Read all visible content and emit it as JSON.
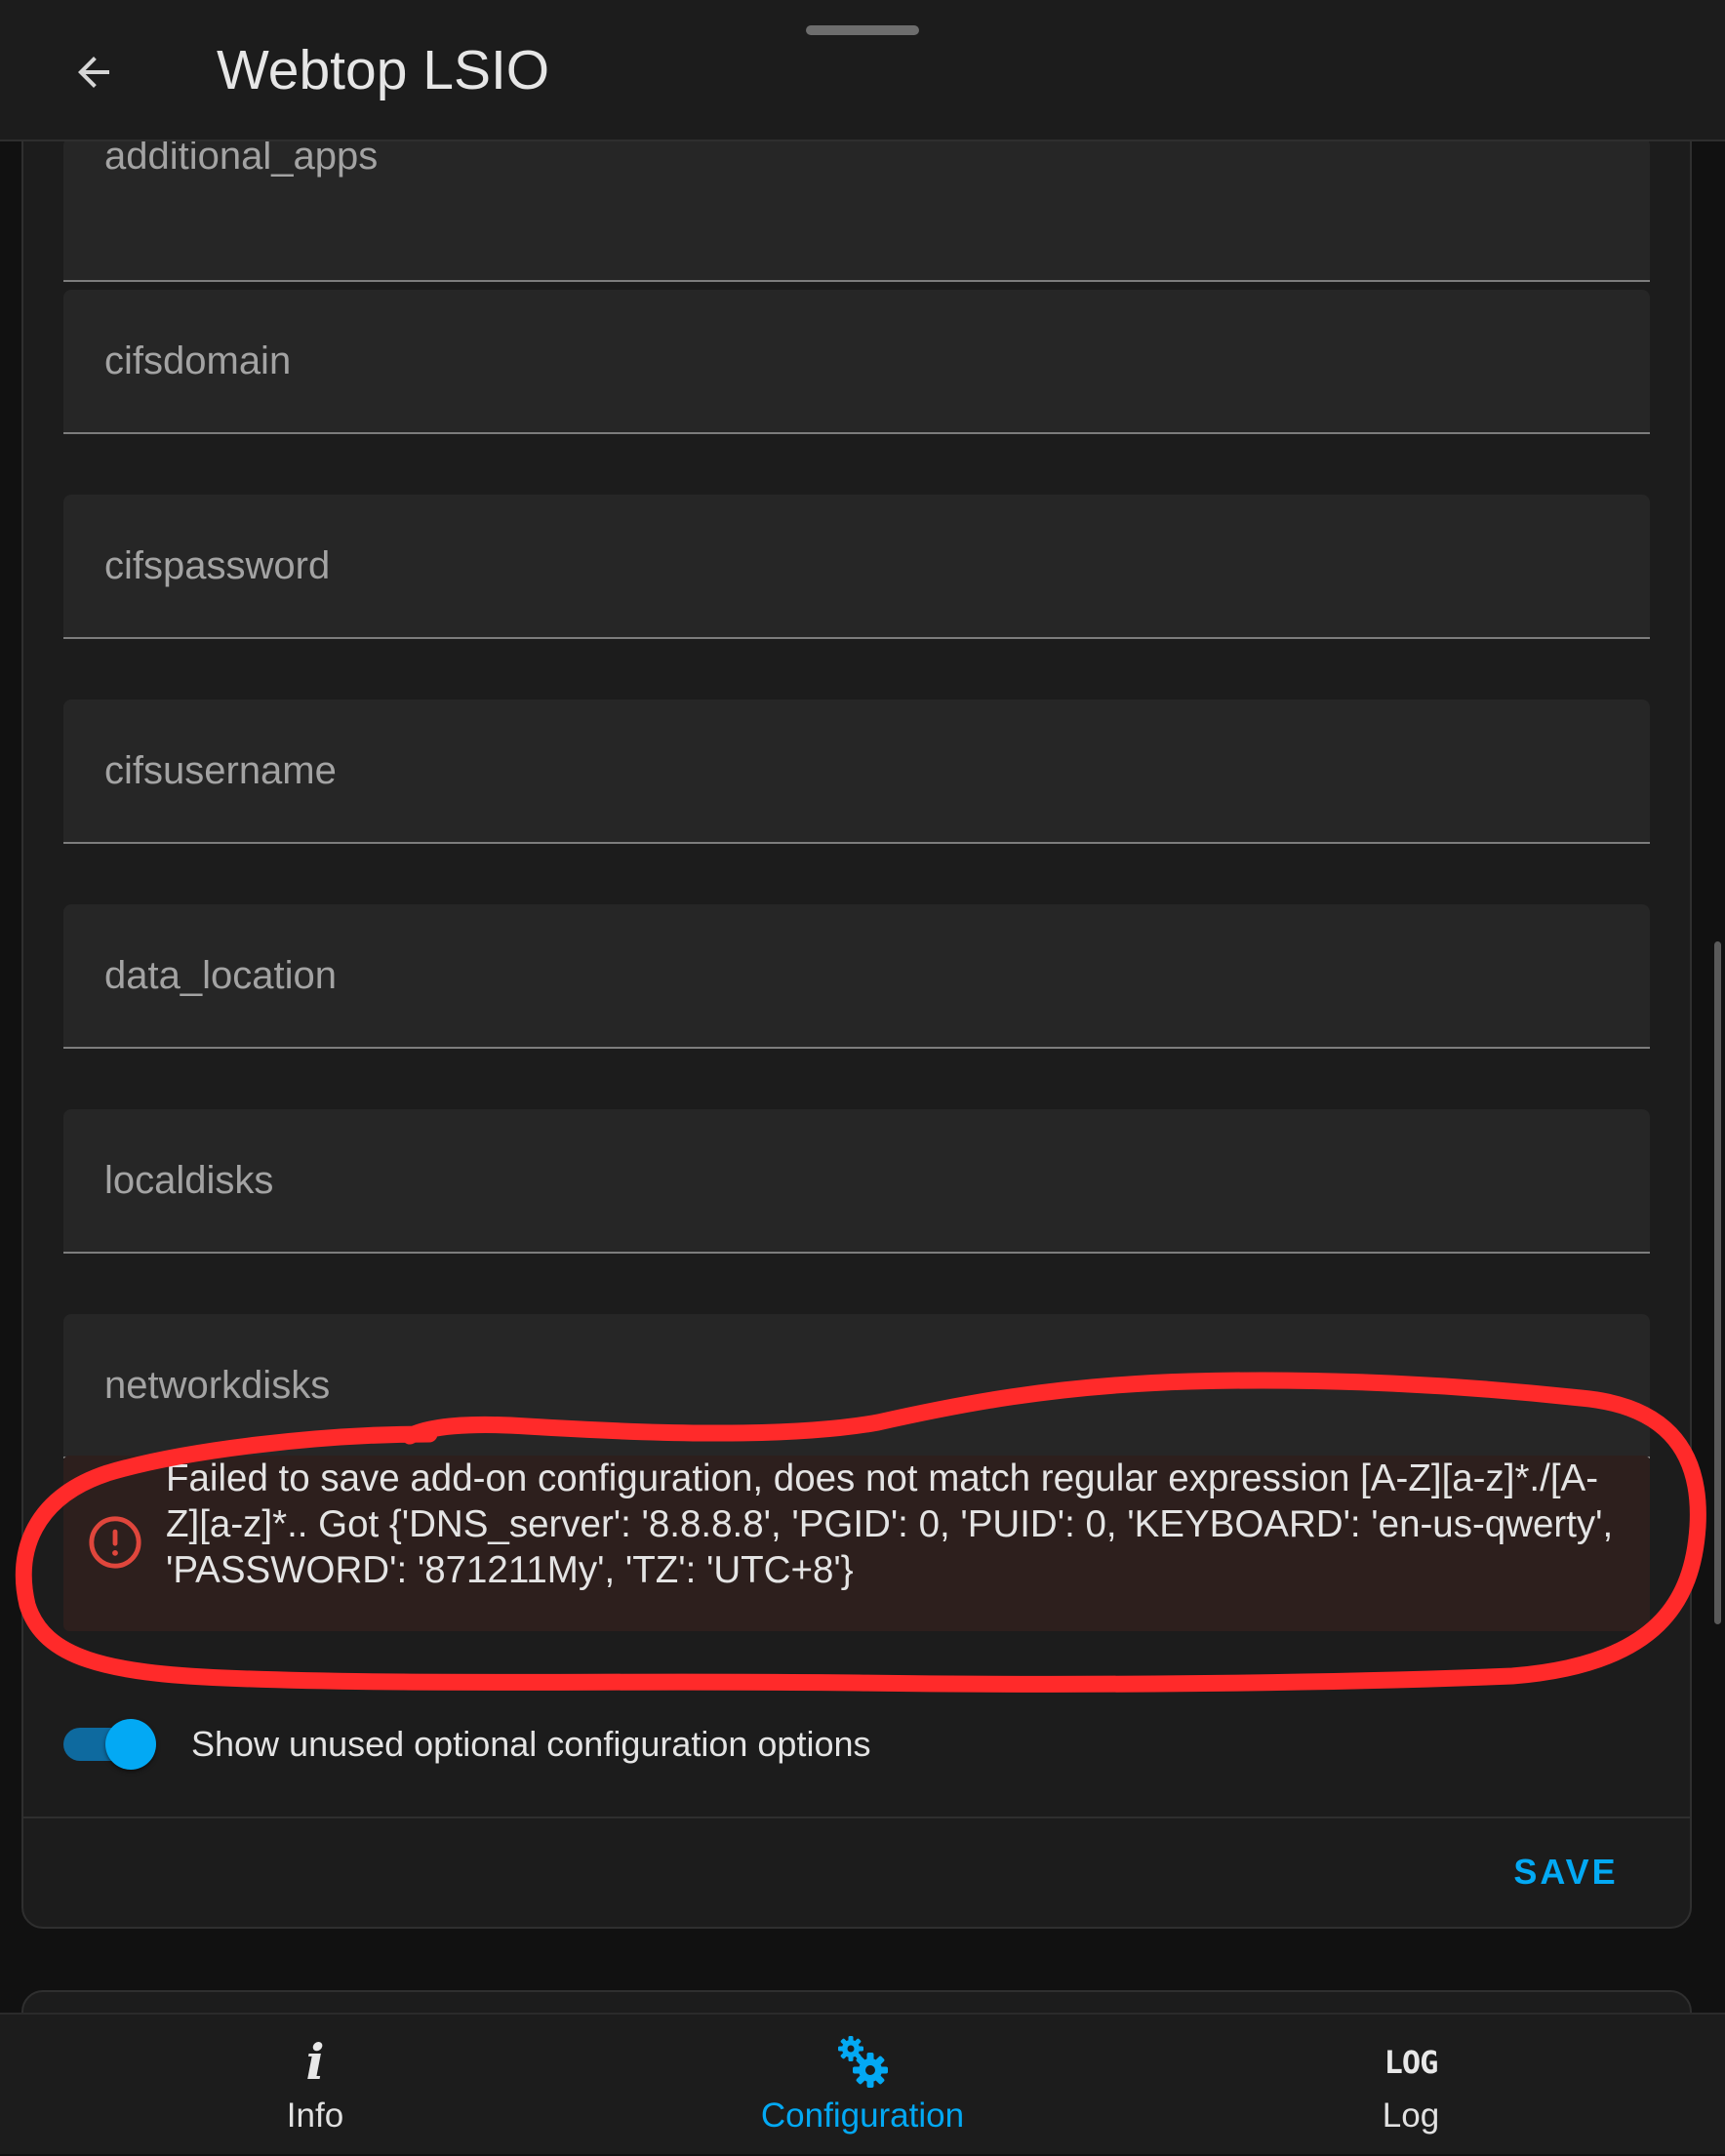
{
  "header": {
    "title": "Webtop LSIO",
    "back_icon": "arrow-left-icon"
  },
  "fields": [
    {
      "label": "additional_apps"
    },
    {
      "label": "cifsdomain"
    },
    {
      "label": "cifspassword"
    },
    {
      "label": "cifsusername"
    },
    {
      "label": "data_location"
    },
    {
      "label": "localdisks"
    },
    {
      "label": "networkdisks"
    }
  ],
  "error": {
    "icon": "alert-circle-icon",
    "message": "Failed to save add-on configuration, does not match regular expression [A-Z][a-z]*./[A-Z][a-z]*.. Got {'DNS_server': '8.8.8.8', 'PGID': 0, 'PUID': 0, 'KEYBOARD': 'en-us-qwerty', 'PASSWORD': '871211My', 'TZ': 'UTC+8'}"
  },
  "toggle": {
    "label": "Show unused optional configuration options",
    "checked": true
  },
  "actions": {
    "save_label": "SAVE"
  },
  "bottom_nav": {
    "items": [
      {
        "label": "Info",
        "icon": "info-icon",
        "active": false
      },
      {
        "label": "Configuration",
        "icon": "cogs-icon",
        "active": true
      },
      {
        "label": "Log",
        "icon": "log-icon",
        "active": false
      }
    ],
    "info_glyph": "i",
    "log_glyph": "LOG"
  },
  "colors": {
    "accent": "#03a9f4",
    "background": "#111111",
    "card": "#1c1c1c",
    "field": "#262626",
    "error_bg": "#2d1f1d",
    "error_icon": "#e0463c",
    "annotation": "#ff2a2a"
  }
}
